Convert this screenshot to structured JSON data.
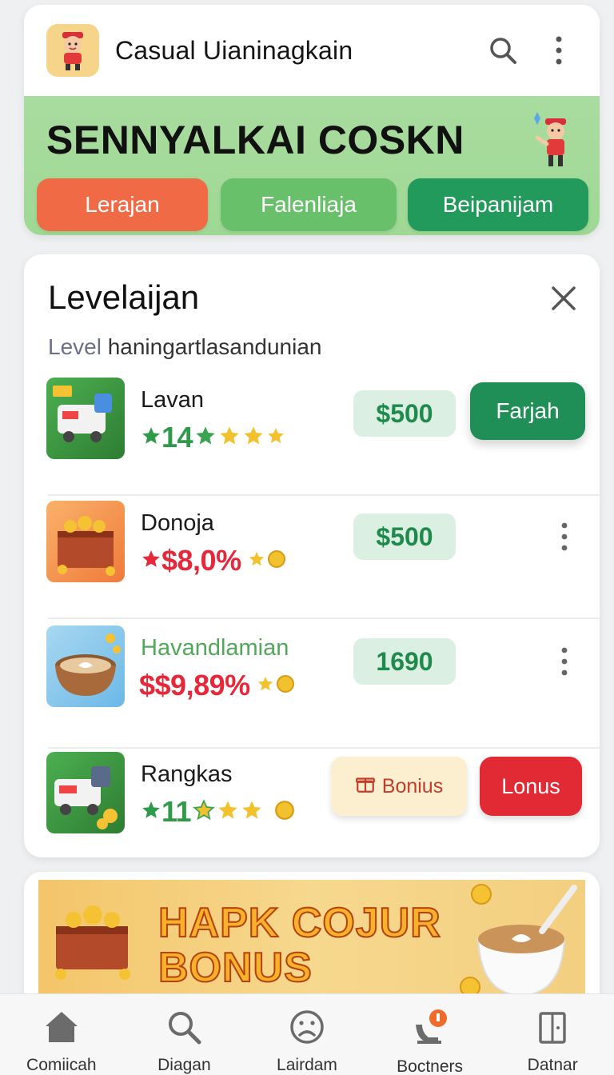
{
  "header": {
    "app_title": "Casual Uianinagkain",
    "avatar_icon": "mascot-icon",
    "search_icon": "search-icon",
    "menu_icon": "more-vertical-icon"
  },
  "hero": {
    "title": "SENNYALKAI COSKN",
    "buttons": [
      {
        "label": "Lerajan",
        "color": "#f06a46"
      },
      {
        "label": "Falenliaja",
        "color": "#68c06a"
      },
      {
        "label": "Beipanijam",
        "color": "#219a5c"
      }
    ]
  },
  "level_panel": {
    "title": "Levelaijan",
    "subtitle_prefix": "Level",
    "subtitle_text": "haningartlasandunian",
    "rows": [
      {
        "name": "Lavan",
        "stat": "14",
        "price": "$500",
        "action": "Farjah"
      },
      {
        "name": "Donoja",
        "stat": "$8,0%",
        "price": "$500"
      },
      {
        "name": "Havandlamian",
        "stat": "$$9,89%",
        "price": "1690"
      },
      {
        "name": "Rangkas",
        "stat": "11",
        "bonus_label": "Bonius",
        "action": "Lonus"
      }
    ]
  },
  "promo": {
    "line1": "HAPK COJUR",
    "line2": "BONUS"
  },
  "bottom_nav": [
    {
      "label": "Comiicah",
      "icon": "home-icon"
    },
    {
      "label": "Diagan",
      "icon": "search-icon"
    },
    {
      "label": "Lairdam",
      "icon": "sad-face-icon"
    },
    {
      "label": "Boctners",
      "icon": "badge-icon"
    },
    {
      "label": "Datnar",
      "icon": "door-icon"
    }
  ],
  "colors": {
    "accent_green": "#219a5c",
    "accent_red": "#e22a35",
    "accent_orange": "#f06a46",
    "hero_bg": "#a9dca0"
  }
}
